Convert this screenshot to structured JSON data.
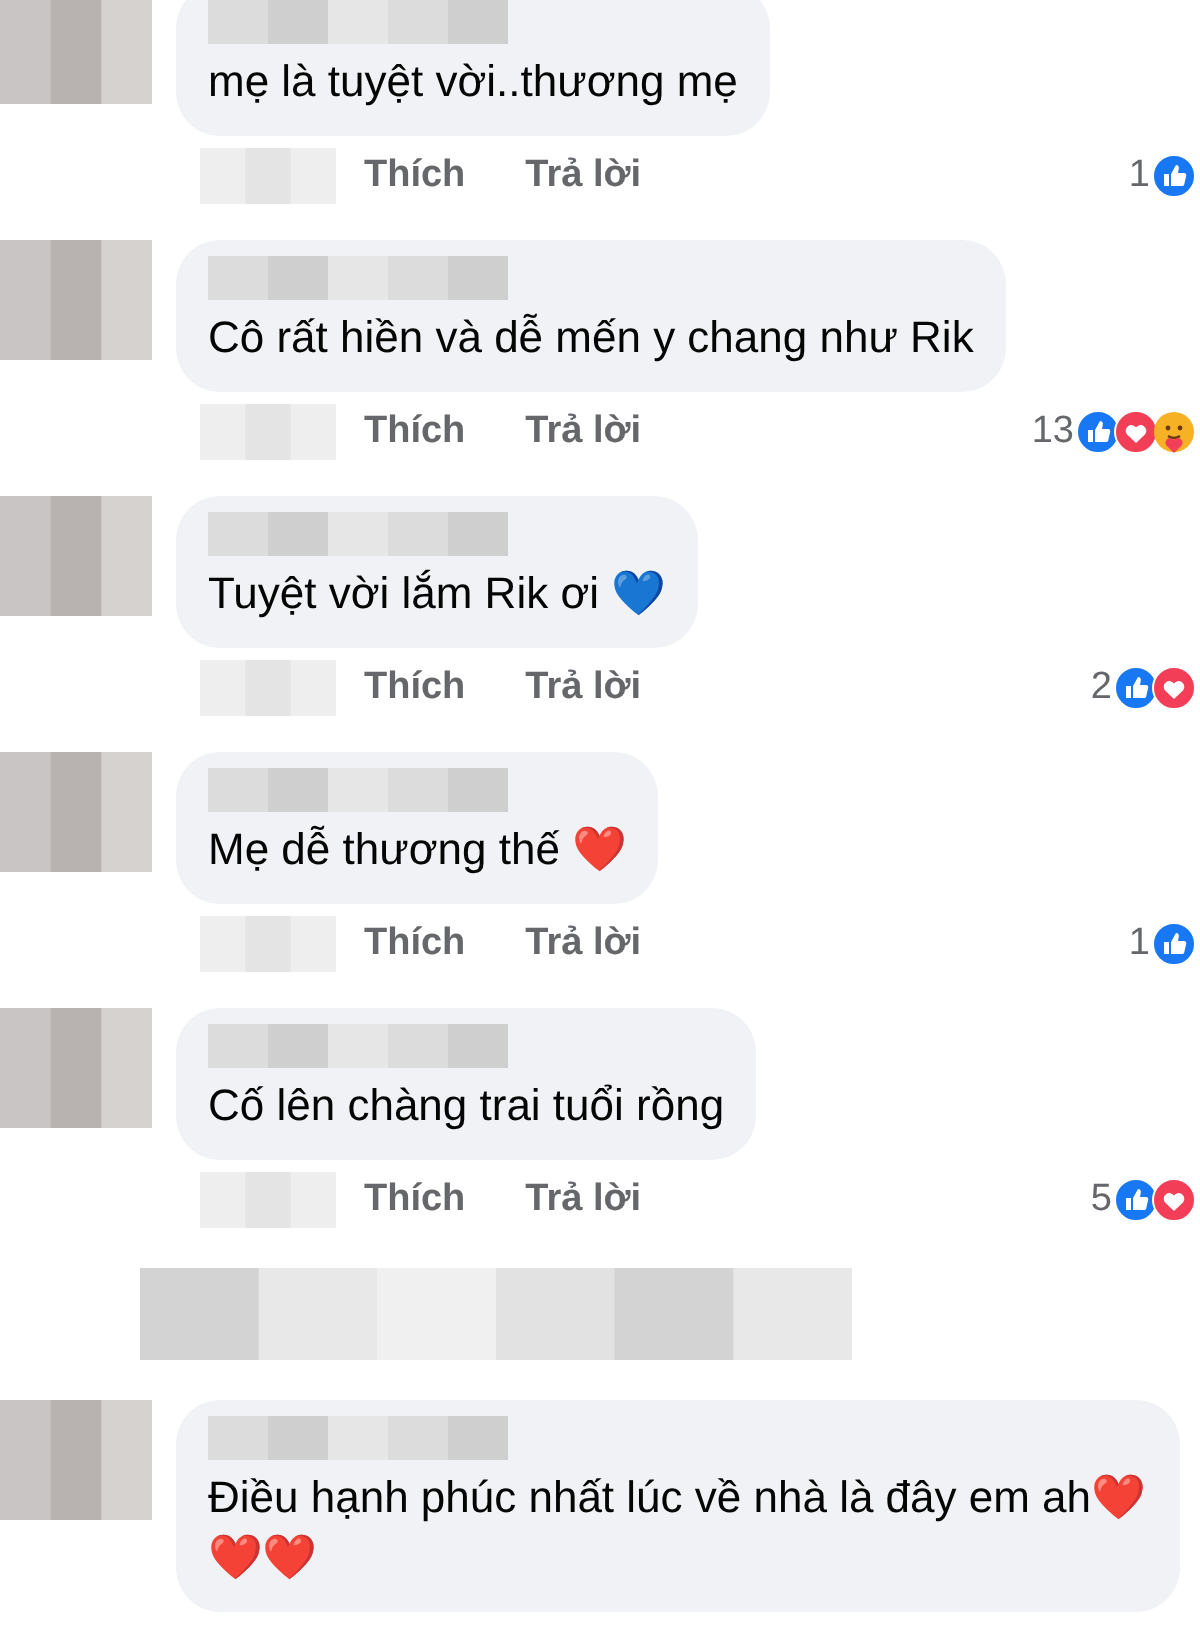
{
  "comments": [
    {
      "text": "mẹ là tuyệt vời..thương mẹ",
      "actions": [
        "Thích",
        "Trả lời"
      ],
      "reaction_count": "1",
      "reactions": [
        {
          "kind": "like"
        }
      ]
    },
    {
      "text": "Cô rất hiền và dễ mến y chang như Rik",
      "actions": [
        "Thích",
        "Trả lời"
      ],
      "reaction_count": "13",
      "reactions": [
        {
          "kind": "like"
        },
        {
          "kind": "love"
        },
        {
          "kind": "care"
        }
      ]
    },
    {
      "text": "Tuyệt vời lắm Rik ơi 💙",
      "actions": [
        "Thích",
        "Trả lời"
      ],
      "reaction_count": "2",
      "reactions": [
        {
          "kind": "like"
        },
        {
          "kind": "love"
        }
      ]
    },
    {
      "text": "Mẹ dễ thương thế ❤️",
      "actions": [
        "Thích",
        "Trả lời"
      ],
      "reaction_count": "1",
      "reactions": [
        {
          "kind": "like"
        }
      ]
    },
    {
      "text": "Cố lên chàng trai tuổi rồng",
      "actions": [
        "Thích",
        "Trả lời"
      ],
      "reaction_count": "5",
      "reactions": [
        {
          "kind": "like"
        },
        {
          "kind": "love"
        }
      ]
    },
    {
      "text": "Điều hạnh phúc nhất lúc về nhà là đây em ah❤️❤️❤️"
    }
  ]
}
